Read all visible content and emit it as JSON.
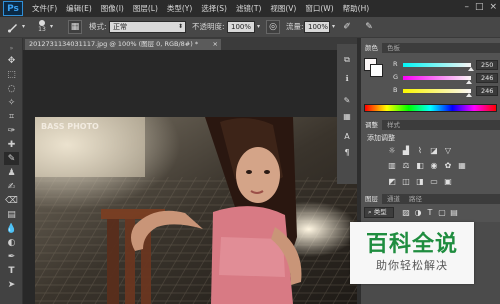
{
  "app": {
    "logo": "Ps"
  },
  "menu": [
    "文件(F)",
    "编辑(E)",
    "图像(I)",
    "图层(L)",
    "类型(Y)",
    "选择(S)",
    "滤镜(T)",
    "视图(V)",
    "窗口(W)",
    "帮助(H)"
  ],
  "window_controls": {
    "minimize": "–",
    "maximize": "□",
    "close": "×"
  },
  "options": {
    "brush_size": "13",
    "mode_label": "模式:",
    "mode_value": "正常",
    "opacity_label": "不透明度:",
    "opacity_value": "100%",
    "flow_label": "流量:",
    "flow_value": "100%"
  },
  "document": {
    "tab_label": "20127311340311​17.jpg @ 100% (图层 0, RGB/8#) *",
    "close": "×"
  },
  "color_panel": {
    "tabs": [
      "颜色",
      "色板"
    ],
    "channels": [
      {
        "label": "R",
        "value": "250",
        "level": 0.98,
        "gradient": "linear-gradient(to right,#00f6f6,#faf6f6)"
      },
      {
        "label": "G",
        "value": "246",
        "level": 0.96,
        "gradient": "linear-gradient(to right,#fa00f6,#faf6f6)"
      },
      {
        "label": "B",
        "value": "246",
        "level": 0.96,
        "gradient": "linear-gradient(to right,#faf600,#faf6f6)"
      }
    ],
    "foreground": "#faf6f6"
  },
  "adjustments_panel": {
    "tabs": [
      "调整",
      "样式"
    ],
    "title": "添加调整"
  },
  "layers_panel": {
    "tabs": [
      "图层",
      "通道",
      "路径"
    ],
    "kind_label": "类型"
  },
  "photo_overlay_text": "BASS PHOTO",
  "watermark": {
    "title": "百科全说",
    "subtitle": "助你轻松解决"
  },
  "icons": {
    "toolbar": [
      "move-icon",
      "marquee-icon",
      "lasso-icon",
      "quick-select-icon",
      "crop-icon",
      "eyedropper-icon",
      "healing-icon",
      "brush-icon",
      "stamp-icon",
      "history-brush-icon",
      "eraser-icon",
      "gradient-icon",
      "blur-icon",
      "dodge-icon",
      "pen-icon",
      "type-icon"
    ]
  }
}
